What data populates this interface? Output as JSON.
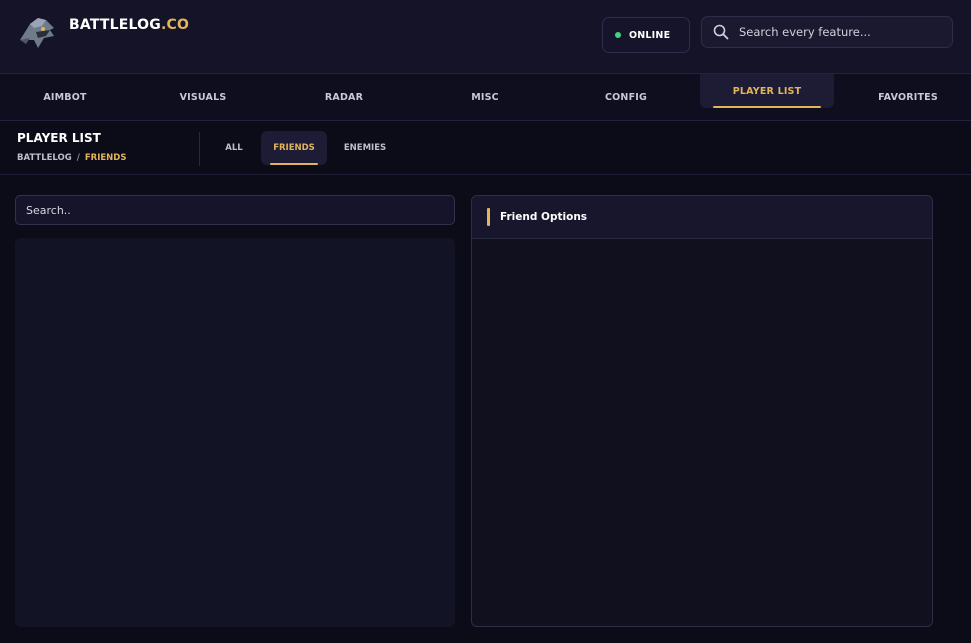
{
  "header": {
    "brand_main": "BATTLELOG",
    "brand_accent": ".CO",
    "logo_icon": "shark-logo-icon",
    "status_label": "ONLINE",
    "search_placeholder": "Search every feature..."
  },
  "nav": {
    "items": [
      {
        "label": "AIMBOT"
      },
      {
        "label": "VISUALS"
      },
      {
        "label": "RADAR"
      },
      {
        "label": "MISC"
      },
      {
        "label": "CONFIG"
      },
      {
        "label": "PLAYER LIST"
      },
      {
        "label": "FAVORITES"
      }
    ],
    "active": "PLAYER LIST"
  },
  "subheader": {
    "title": "PLAYER LIST",
    "breadcrumb_root": "BATTLELOG",
    "breadcrumb_sep": "/",
    "breadcrumb_current": "FRIENDS",
    "tabs": [
      {
        "label": "ALL"
      },
      {
        "label": "FRIENDS"
      },
      {
        "label": "ENEMIES"
      }
    ],
    "active_tab": "FRIENDS"
  },
  "list": {
    "search_placeholder": "Search.."
  },
  "panel": {
    "title": "Friend Options"
  },
  "colors": {
    "accent": "#e2b55c",
    "online": "#3ed77a",
    "background": "#0c0b18"
  }
}
